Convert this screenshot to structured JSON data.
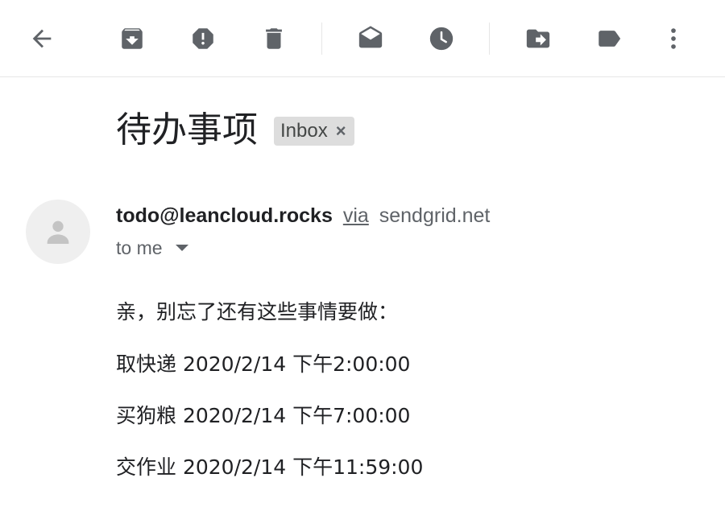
{
  "toolbar": {
    "buttons": [
      {
        "name": "back",
        "icon": "arrow-left-icon"
      },
      {
        "name": "archive",
        "icon": "archive-icon"
      },
      {
        "name": "report-spam",
        "icon": "report-spam-icon"
      },
      {
        "name": "delete",
        "icon": "trash-icon"
      },
      {
        "name": "mark-unread",
        "icon": "mark-unread-icon"
      },
      {
        "name": "snooze",
        "icon": "clock-icon"
      },
      {
        "name": "move-to",
        "icon": "move-to-icon"
      },
      {
        "name": "labels",
        "icon": "label-icon"
      },
      {
        "name": "more",
        "icon": "more-vert-icon"
      }
    ],
    "icon_color": "#5f6368"
  },
  "email": {
    "subject": "待办事项",
    "label": {
      "text": "Inbox",
      "remove_symbol": "×"
    },
    "sender": {
      "email": "todo@leancloud.rocks",
      "via_text": "via",
      "via_domain": "sendgrid.net"
    },
    "recipient": "to me",
    "body": {
      "greeting": "亲，别忘了还有这些事情要做：",
      "items": [
        "取快递 2020/2/14 下午2:00:00",
        "买狗粮 2020/2/14 下午7:00:00",
        "交作业 2020/2/14 下午11:59:00"
      ]
    }
  }
}
